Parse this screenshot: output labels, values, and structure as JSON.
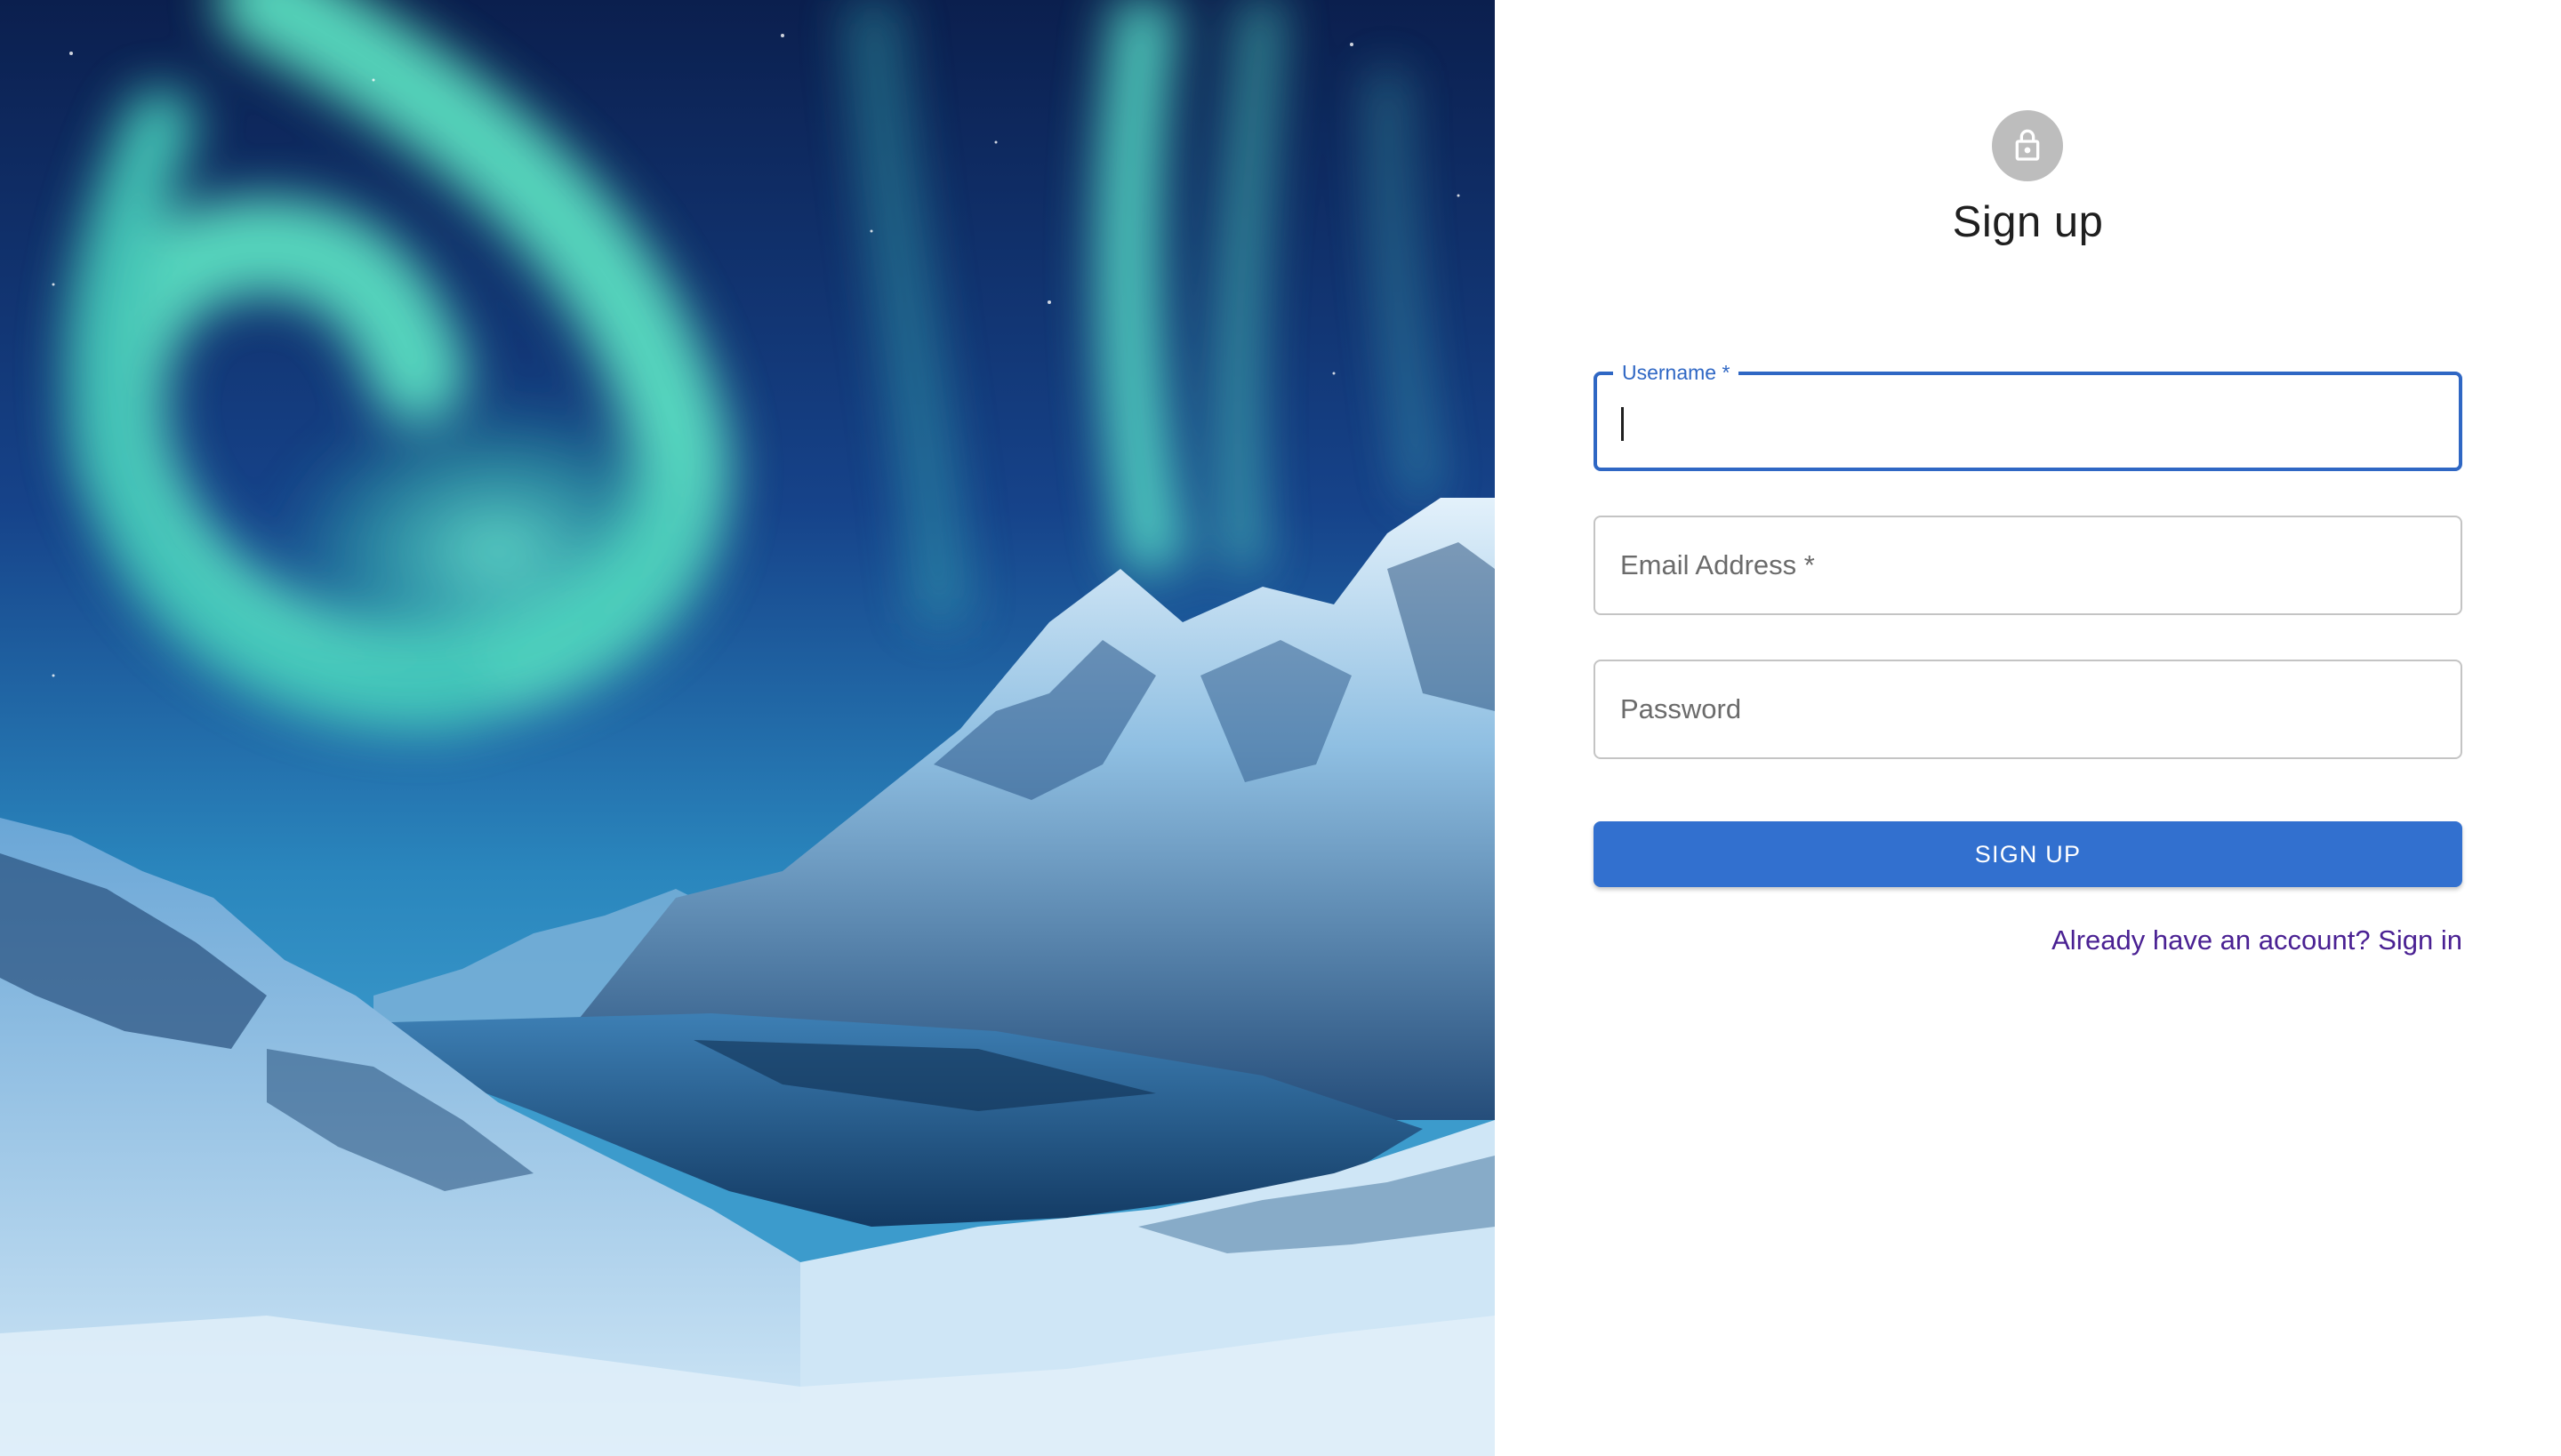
{
  "hero": {
    "image_label": "aurora-mountain-fjord-photo",
    "colors": {
      "sky_top": "#0e2456",
      "aurora": "#5fe8c6",
      "snow": "#b8d8ef",
      "water": "#1b3f68"
    }
  },
  "form": {
    "title": "Sign up",
    "icon": "lock-icon",
    "fields": {
      "username": {
        "label": "Username *",
        "value": "",
        "focused": true
      },
      "email": {
        "placeholder": "Email Address *",
        "value": ""
      },
      "password": {
        "placeholder": "Password",
        "value": ""
      }
    },
    "submit_label": "SIGN UP",
    "signin_link": "Already have an account? Sign in"
  },
  "colors": {
    "accent": "#2f67c4",
    "button": "#3270cf",
    "link": "#4a2193",
    "avatar_bg": "#bdbdbd"
  }
}
